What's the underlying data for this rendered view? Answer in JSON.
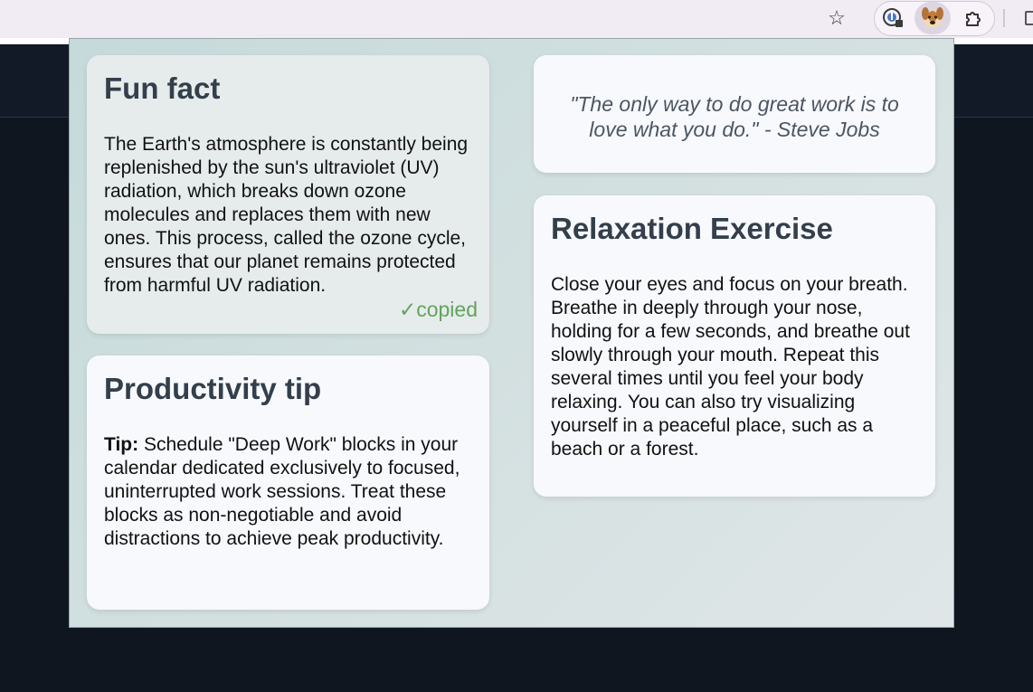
{
  "toolbar": {
    "bookmark_icon": "star-icon",
    "extensions": [
      "password-manager-icon",
      "dog-extension-icon",
      "puzzle-icon"
    ]
  },
  "cards": {
    "fun_fact": {
      "title": "Fun fact",
      "body": "The Earth's atmosphere is constantly being replenished by the sun's ultraviolet (UV) radiation, which breaks down ozone molecules and replaces them with new ones. This process, called the ozone cycle, ensures that our planet remains protected from harmful UV radiation.",
      "status": "✓copied"
    },
    "productivity": {
      "title": "Productivity tip",
      "tip_label": "Tip:",
      "body": " Schedule \"Deep Work\" blocks in your calendar dedicated exclusively to focused, uninterrupted work sessions. Treat these blocks as non-negotiable and avoid distractions to achieve peak productivity."
    },
    "quote": {
      "text": "\"The only way to do great work is to love what you do.\" - Steve Jobs"
    },
    "relaxation": {
      "title": "Relaxation Exercise",
      "body": "Close your eyes and focus on your breath. Breathe in deeply through your nose, holding for a few seconds, and breathe out slowly through your mouth. Repeat this several times until you feel your body relaxing. You can also try visualizing yourself in a peaceful place, such as a beach or a forest."
    }
  },
  "colors": {
    "copied": "#62a45a",
    "title": "#333f4b",
    "quote": "#4b5662"
  }
}
